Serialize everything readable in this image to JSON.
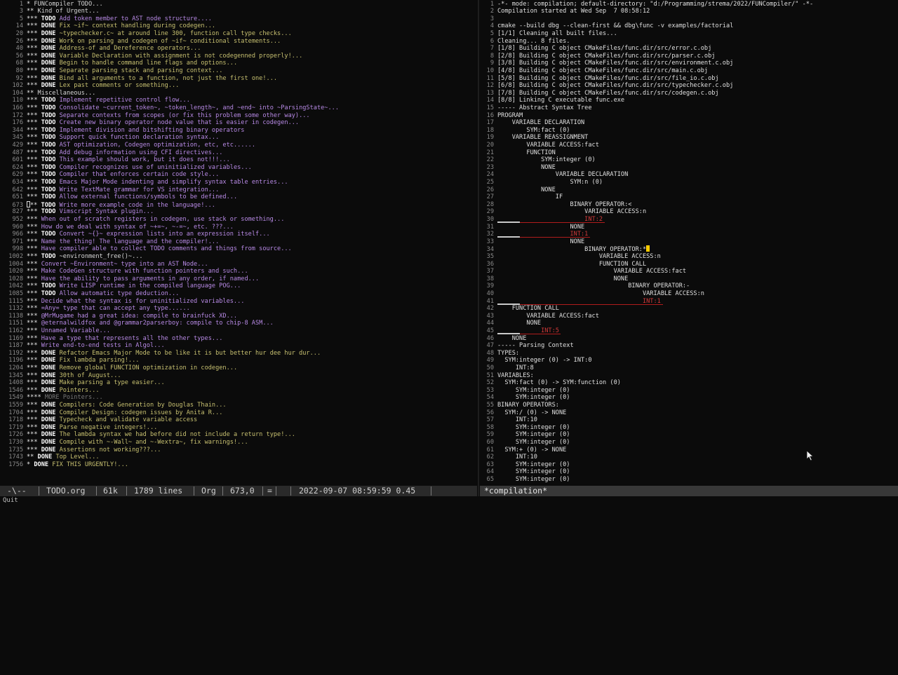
{
  "left": {
    "lines": [
      {
        "n": "1",
        "stars": "*",
        "kw": "",
        "text": "FUNCompiler TODO...",
        "cls": "t-plain"
      },
      {
        "n": "3",
        "stars": "**",
        "kw": "",
        "text": "Kind of Urgent...",
        "cls": "t-plain"
      },
      {
        "n": "5",
        "stars": "***",
        "kw": "TODO",
        "text": "Add token member to AST node structure....",
        "cls": "t-todo"
      },
      {
        "n": "14",
        "stars": "***",
        "kw": "DONE",
        "text": "Fix ~if~ context handling during codegen...",
        "cls": "t-done"
      },
      {
        "n": "20",
        "stars": "***",
        "kw": "DONE",
        "text": "~typechecker.c~ at around line 300, function call type checks...",
        "cls": "t-done"
      },
      {
        "n": "26",
        "stars": "***",
        "kw": "DONE",
        "text": "Work on parsing and codegen of ~if~ conditional statements...",
        "cls": "t-done"
      },
      {
        "n": "40",
        "stars": "***",
        "kw": "DONE",
        "text": "Address-of and Dereference operators...",
        "cls": "t-done"
      },
      {
        "n": "56",
        "stars": "***",
        "kw": "DONE",
        "text": "Variable Declaration with assignment is not codegenned properly!...",
        "cls": "t-done"
      },
      {
        "n": "68",
        "stars": "***",
        "kw": "DONE",
        "text": "Begin to handle command line flags and options...",
        "cls": "t-done"
      },
      {
        "n": "80",
        "stars": "***",
        "kw": "DONE",
        "text": "Separate parsing stack and parsing context...",
        "cls": "t-done"
      },
      {
        "n": "92",
        "stars": "***",
        "kw": "DONE",
        "text": "Bind all arguments to a function, not just the first one!...",
        "cls": "t-done"
      },
      {
        "n": "102",
        "stars": "***",
        "kw": "DONE",
        "text": "Lex past comments or something...",
        "cls": "t-done"
      },
      {
        "n": "104",
        "stars": "**",
        "kw": "",
        "text": "Miscellaneous...",
        "cls": "t-plain"
      },
      {
        "n": "110",
        "stars": "***",
        "kw": "TODO",
        "text": "Implement repetitive control flow...",
        "cls": "t-todo"
      },
      {
        "n": "166",
        "stars": "***",
        "kw": "TODO",
        "text": "Consolidate ~current_token~, ~token_length~, and ~end~ into ~ParsingState~...",
        "cls": "t-todo"
      },
      {
        "n": "172",
        "stars": "***",
        "kw": "TODO",
        "text": "Separate contexts from scopes (or fix this problem some other way)...",
        "cls": "t-todo"
      },
      {
        "n": "176",
        "stars": "***",
        "kw": "TODO",
        "text": "Create new binary operator node value that is easier in codegen...",
        "cls": "t-todo"
      },
      {
        "n": "344",
        "stars": "***",
        "kw": "TODO",
        "text": "Implement division and bitshifting binary operators",
        "cls": "t-todo"
      },
      {
        "n": "345",
        "stars": "***",
        "kw": "TODO",
        "text": "Support quick function declaration syntax...",
        "cls": "t-todo"
      },
      {
        "n": "429",
        "stars": "***",
        "kw": "TODO",
        "text": "AST optimization, Codegen optimization, etc, etc......",
        "cls": "t-todo"
      },
      {
        "n": "487",
        "stars": "***",
        "kw": "TODO",
        "text": "Add debug information using CFI directives...",
        "cls": "t-todo"
      },
      {
        "n": "601",
        "stars": "***",
        "kw": "TODO",
        "text": "This example should work, but it does not!!!...",
        "cls": "t-todo"
      },
      {
        "n": "624",
        "stars": "***",
        "kw": "TODO",
        "text": "Compiler recognizes use of uninitialized variables...",
        "cls": "t-todo"
      },
      {
        "n": "629",
        "stars": "***",
        "kw": "TODO",
        "text": "Compiler that enforces certain code style...",
        "cls": "t-todo"
      },
      {
        "n": "634",
        "stars": "***",
        "kw": "TODO",
        "text": "Emacs Major Mode indenting and simplify syntax table entries...",
        "cls": "t-todo"
      },
      {
        "n": "642",
        "stars": "***",
        "kw": "TODO",
        "text": "Write TextMate grammar for VS integration...",
        "cls": "t-todo"
      },
      {
        "n": "651",
        "stars": "***",
        "kw": "TODO",
        "text": "Allow external functions/symbols to be defined...",
        "cls": "t-todo"
      },
      {
        "n": "673",
        "stars": "**",
        "kw": "TODO",
        "text": "Write more example code in the language!...",
        "cls": "t-todo",
        "cursor": true
      },
      {
        "n": "827",
        "stars": "***",
        "kw": "TODO",
        "text": "Vimscript Syntax plugin...",
        "cls": "t-todo"
      },
      {
        "n": "952",
        "stars": "***",
        "kw": "",
        "text": "When out of scratch registers in codegen, use stack or something...",
        "cls": "t-todo"
      },
      {
        "n": "960",
        "stars": "***",
        "kw": "",
        "text": "How do we deal with syntax of ~+=~, ~-=~, etc. ???...",
        "cls": "t-todo"
      },
      {
        "n": "966",
        "stars": "***",
        "kw": "TODO",
        "text": "Convert ~{}~ expression lists into an expression itself...",
        "cls": "t-todo"
      },
      {
        "n": "971",
        "stars": "***",
        "kw": "",
        "text": "Name the thing! The language and the compiler!...",
        "cls": "t-todo"
      },
      {
        "n": "998",
        "stars": "***",
        "kw": "",
        "text": "Have compiler able to collect TODO comments and things from source...",
        "cls": "t-todo"
      },
      {
        "n": "1002",
        "stars": "***",
        "kw": "TODO",
        "text": "~environment_free()~...",
        "cls": "t-plain"
      },
      {
        "n": "1004",
        "stars": "***",
        "kw": "",
        "text": "Convert ~Environment~ type into an AST Node...",
        "cls": "t-todo"
      },
      {
        "n": "1020",
        "stars": "***",
        "kw": "",
        "text": "Make CodeGen structure with function pointers and such...",
        "cls": "t-todo"
      },
      {
        "n": "1028",
        "stars": "***",
        "kw": "",
        "text": "Have the ability to pass arguments in any order, if named...",
        "cls": "t-todo"
      },
      {
        "n": "1042",
        "stars": "***",
        "kw": "TODO",
        "text": "Write LISP runtime in the compiled language POG...",
        "cls": "t-todo"
      },
      {
        "n": "1085",
        "stars": "***",
        "kw": "TODO",
        "text": "Allow automatic type deduction...",
        "cls": "t-todo"
      },
      {
        "n": "1115",
        "stars": "***",
        "kw": "",
        "text": "Decide what the syntax is for uninitialized variables...",
        "cls": "t-todo"
      },
      {
        "n": "1132",
        "stars": "***",
        "kw": "",
        "text": "=Any= type that can accept any type......",
        "cls": "t-todo"
      },
      {
        "n": "1138",
        "stars": "***",
        "kw": "",
        "text": "@MrMugame had a great idea: compile to brainfuck XD...",
        "cls": "t-todo"
      },
      {
        "n": "1151",
        "stars": "***",
        "kw": "",
        "text": "@eternalwildfox and @grammar2parserboy: compile to chip-8 ASM...",
        "cls": "t-todo"
      },
      {
        "n": "1162",
        "stars": "***",
        "kw": "",
        "text": "Unnamed Variable...",
        "cls": "t-todo"
      },
      {
        "n": "1169",
        "stars": "***",
        "kw": "",
        "text": "Have a type that represents all the other types...",
        "cls": "t-todo"
      },
      {
        "n": "1187",
        "stars": "***",
        "kw": "",
        "text": "Write end-to-end tests in Algol...",
        "cls": "t-todo"
      },
      {
        "n": "1192",
        "stars": "***",
        "kw": "DONE",
        "text": "Refactor Emacs Major Mode to be like it is but better hur dee hur dur...",
        "cls": "t-done"
      },
      {
        "n": "1196",
        "stars": "***",
        "kw": "DONE",
        "text": "Fix lambda parsing!...",
        "cls": "t-done"
      },
      {
        "n": "1204",
        "stars": "***",
        "kw": "DONE",
        "text": "Remove global FUNCTION optimization in codegen...",
        "cls": "t-done"
      },
      {
        "n": "1345",
        "stars": "***",
        "kw": "DONE",
        "text": "30th of August...",
        "cls": "t-done"
      },
      {
        "n": "1408",
        "stars": "***",
        "kw": "DONE",
        "text": "Make parsing a type easier...",
        "cls": "t-done"
      },
      {
        "n": "1546",
        "stars": "***",
        "kw": "DONE",
        "text": "Pointers...",
        "cls": "t-done"
      },
      {
        "n": "1549",
        "stars": "****",
        "kw": "",
        "text": "MORE Pointers...",
        "cls": "t-dim"
      },
      {
        "n": "1559",
        "stars": "***",
        "kw": "DONE",
        "text": "Compilers: Code Generation by Douglas Thain...",
        "cls": "t-done"
      },
      {
        "n": "1704",
        "stars": "***",
        "kw": "DONE",
        "text": "Compiler Design: codegen issues by Anita R...",
        "cls": "t-done"
      },
      {
        "n": "1718",
        "stars": "***",
        "kw": "DONE",
        "text": "Typecheck and validate variable access",
        "cls": "t-done"
      },
      {
        "n": "1719",
        "stars": "***",
        "kw": "DONE",
        "text": "Parse negative integers!...",
        "cls": "t-done"
      },
      {
        "n": "1726",
        "stars": "***",
        "kw": "DONE",
        "text": "The lambda syntax we had before did not include a return type!...",
        "cls": "t-done"
      },
      {
        "n": "1730",
        "stars": "***",
        "kw": "DONE",
        "text": "Compile with ~-Wall~ and ~-Wextra~, fix warnings!...",
        "cls": "t-done"
      },
      {
        "n": "1735",
        "stars": "***",
        "kw": "DONE",
        "text": "Assertions not working???...",
        "cls": "t-done"
      },
      {
        "n": "1743",
        "stars": "**",
        "kw": "DONE",
        "text": "Top Level...",
        "cls": "t-done"
      },
      {
        "n": "1756",
        "stars": "*",
        "kw": "DONE",
        "text": "FIX THIS URGENTLY!...",
        "cls": "t-done"
      }
    ]
  },
  "right": {
    "lines": [
      {
        "n": "1",
        "text": "-*- mode: compilation; default-directory: \"d:/Programming/strema/2022/FUNCompiler/\" -*-"
      },
      {
        "n": "2",
        "text": "Compilation started at Wed Sep  7 08:58:12"
      },
      {
        "n": "3",
        "text": ""
      },
      {
        "n": "4",
        "text": "cmake --build dbg --clean-first && dbg\\func -v examples/factorial"
      },
      {
        "n": "5",
        "text": "[1/1] Cleaning all built files..."
      },
      {
        "n": "6",
        "text": "Cleaning... 8 files."
      },
      {
        "n": "7",
        "text": "[1/8] Building C object CMakeFiles/func.dir/src/error.c.obj"
      },
      {
        "n": "8",
        "text": "[2/8] Building C object CMakeFiles/func.dir/src/parser.c.obj"
      },
      {
        "n": "9",
        "text": "[3/8] Building C object CMakeFiles/func.dir/src/environment.c.obj"
      },
      {
        "n": "10",
        "text": "[4/8] Building C object CMakeFiles/func.dir/src/main.c.obj"
      },
      {
        "n": "11",
        "text": "[5/8] Building C object CMakeFiles/func.dir/src/file_io.c.obj"
      },
      {
        "n": "12",
        "text": "[6/8] Building C object CMakeFiles/func.dir/src/typechecker.c.obj"
      },
      {
        "n": "13",
        "text": "[7/8] Building C object CMakeFiles/func.dir/src/codegen.c.obj"
      },
      {
        "n": "14",
        "text": "[8/8] Linking C executable func.exe"
      },
      {
        "n": "15",
        "text": "----- Abstract Syntax Tree"
      },
      {
        "n": "16",
        "text": "PROGRAM"
      },
      {
        "n": "17",
        "text": "    VARIABLE DECLARATION"
      },
      {
        "n": "18",
        "text": "        SYM:fact (0)"
      },
      {
        "n": "19",
        "text": "    VARIABLE REASSIGNMENT"
      },
      {
        "n": "20",
        "text": "        VARIABLE ACCESS:fact"
      },
      {
        "n": "21",
        "text": "        FUNCTION"
      },
      {
        "n": "22",
        "text": "            SYM:integer (0)"
      },
      {
        "n": "23",
        "text": "            NONE"
      },
      {
        "n": "24",
        "text": "                VARIABLE DECLARATION"
      },
      {
        "n": "25",
        "text": "                    SYM:n (0)"
      },
      {
        "n": "26",
        "text": "            NONE"
      },
      {
        "n": "27",
        "text": "                IF"
      },
      {
        "n": "28",
        "text": "                    BINARY OPERATOR:<"
      },
      {
        "n": "29",
        "text": "                        VARIABLE ACCESS:n"
      },
      {
        "n": "30",
        "text": "                        INT:2",
        "err": true
      },
      {
        "n": "31",
        "text": "                    NONE"
      },
      {
        "n": "32",
        "text": "                    INT:1",
        "err": true
      },
      {
        "n": "33",
        "text": "                    NONE"
      },
      {
        "n": "34",
        "text": "                        BINARY OPERATOR:*",
        "cursor": true
      },
      {
        "n": "35",
        "text": "                            VARIABLE ACCESS:n"
      },
      {
        "n": "36",
        "text": "                            FUNCTION CALL"
      },
      {
        "n": "37",
        "text": "                                VARIABLE ACCESS:fact"
      },
      {
        "n": "38",
        "text": "                                NONE"
      },
      {
        "n": "39",
        "text": "                                    BINARY OPERATOR:-"
      },
      {
        "n": "40",
        "text": "                                        VARIABLE ACCESS:n"
      },
      {
        "n": "41",
        "text": "                                        INT:1",
        "err": true
      },
      {
        "n": "42",
        "text": "    FUNCTION CALL"
      },
      {
        "n": "43",
        "text": "        VARIABLE ACCESS:fact"
      },
      {
        "n": "44",
        "text": "        NONE"
      },
      {
        "n": "45",
        "text": "            INT:5",
        "err": true
      },
      {
        "n": "46",
        "text": "    NONE"
      },
      {
        "n": "47",
        "text": "----- Parsing Context"
      },
      {
        "n": "48",
        "text": "TYPES:"
      },
      {
        "n": "49",
        "text": "  SYM:integer (0) -> INT:0"
      },
      {
        "n": "50",
        "text": "     INT:8"
      },
      {
        "n": "51",
        "text": "VARIABLES:"
      },
      {
        "n": "52",
        "text": "  SYM:fact (0) -> SYM:function (0)"
      },
      {
        "n": "53",
        "text": "     SYM:integer (0)"
      },
      {
        "n": "54",
        "text": "     SYM:integer (0)"
      },
      {
        "n": "55",
        "text": "BINARY OPERATORS:"
      },
      {
        "n": "56",
        "text": "  SYM:/ (0) -> NONE"
      },
      {
        "n": "57",
        "text": "     INT:10"
      },
      {
        "n": "58",
        "text": "     SYM:integer (0)"
      },
      {
        "n": "59",
        "text": "     SYM:integer (0)"
      },
      {
        "n": "60",
        "text": "     SYM:integer (0)"
      },
      {
        "n": "61",
        "text": "  SYM:+ (0) -> NONE"
      },
      {
        "n": "62",
        "text": "     INT:10"
      },
      {
        "n": "63",
        "text": "     SYM:integer (0)"
      },
      {
        "n": "64",
        "text": "     SYM:integer (0)"
      },
      {
        "n": "65",
        "text": "     SYM:integer (0)"
      }
    ]
  },
  "modeline_left": {
    "state": "-\\--",
    "buffer": "TODO.org",
    "size": "61k",
    "lines": "1789 lines",
    "mode": "Org",
    "position": "673,0",
    "encoding": "=",
    "datetime": "2022-09-07 08:59:59 0.45"
  },
  "modeline_right": {
    "buffer": "*compilation*"
  },
  "echo": "Quit",
  "colors": {
    "todo": "#b88ae6",
    "done": "#c7c070",
    "error": "#d23a3a",
    "cursor": "#ffcc00"
  },
  "pointer_icon": "mouse-pointer-icon"
}
